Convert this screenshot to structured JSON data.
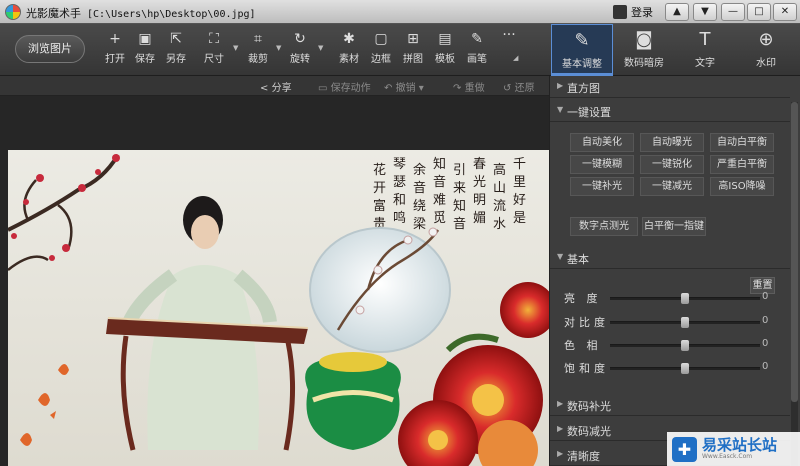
{
  "titlebar": {
    "app_name": "光影魔术手",
    "file_path": "[C:\\Users\\hp\\Desktop\\00.jpg]",
    "login": "登录"
  },
  "window_controls": [
    "▲",
    "▼",
    "—",
    "□",
    "✕"
  ],
  "browse": "浏览图片",
  "tools": [
    {
      "icon": "+",
      "label": "打开"
    },
    {
      "icon": "▣",
      "label": "保存"
    },
    {
      "icon": "⇱",
      "label": "另存"
    },
    {
      "icon": "⛶",
      "label": "尺寸"
    },
    {
      "icon": "⌗",
      "label": "裁剪"
    },
    {
      "icon": "↻",
      "label": "旋转"
    },
    {
      "icon": "✱",
      "label": "素材"
    },
    {
      "icon": "▢",
      "label": "边框"
    },
    {
      "icon": "⊞",
      "label": "拼图"
    },
    {
      "icon": "▤",
      "label": "模板"
    },
    {
      "icon": "✎",
      "label": "画笔"
    },
    {
      "icon": "···",
      "label": ""
    }
  ],
  "panel_tabs": [
    {
      "icon": "✎",
      "label": "基本调整"
    },
    {
      "icon": "◙",
      "label": "数码暗房"
    },
    {
      "icon": "T",
      "label": "文字"
    },
    {
      "icon": "⊕",
      "label": "水印"
    }
  ],
  "actions": {
    "share": "分享",
    "save_action": "保存动作",
    "undo": "撤销",
    "redo": "重做",
    "restore": "还原"
  },
  "sidebar": {
    "histogram": "直方图",
    "oneclick": "一键设置",
    "buttons": [
      "自动美化",
      "自动曝光",
      "自动白平衡",
      "一键模糊",
      "一键锐化",
      "严重白平衡",
      "一键补光",
      "一键减光",
      "高ISO降噪",
      "数字点测光",
      "白平衡一指键"
    ],
    "basic": "基本",
    "reset": "重置",
    "sliders": [
      {
        "label": "亮 度",
        "value": "0",
        "level": 0.5
      },
      {
        "label": "对比度",
        "value": "0",
        "level": 0.5
      },
      {
        "label": "色 相",
        "value": "0",
        "level": 0.5
      },
      {
        "label": "饱和度",
        "value": "0",
        "level": 0.5
      }
    ],
    "fill_light": "数码补光",
    "reduce_light": "数码减光",
    "sharpness": "清晰度"
  },
  "photo": {
    "calligraphy": [
      "千里好是",
      "高山流水",
      "春光明媚",
      "引来知音",
      "知音难觅",
      "余音绕梁",
      "琴瑟和鸣",
      "花开富贵"
    ]
  },
  "watermark": {
    "logo": "✚",
    "title": "易采站长站",
    "subtitle": "Www.Easck.Com"
  },
  "colors": {
    "accent": "#5b8ed6",
    "panel": "#3d3d3d",
    "toolbar": "#404040",
    "canvas": "#262626"
  }
}
